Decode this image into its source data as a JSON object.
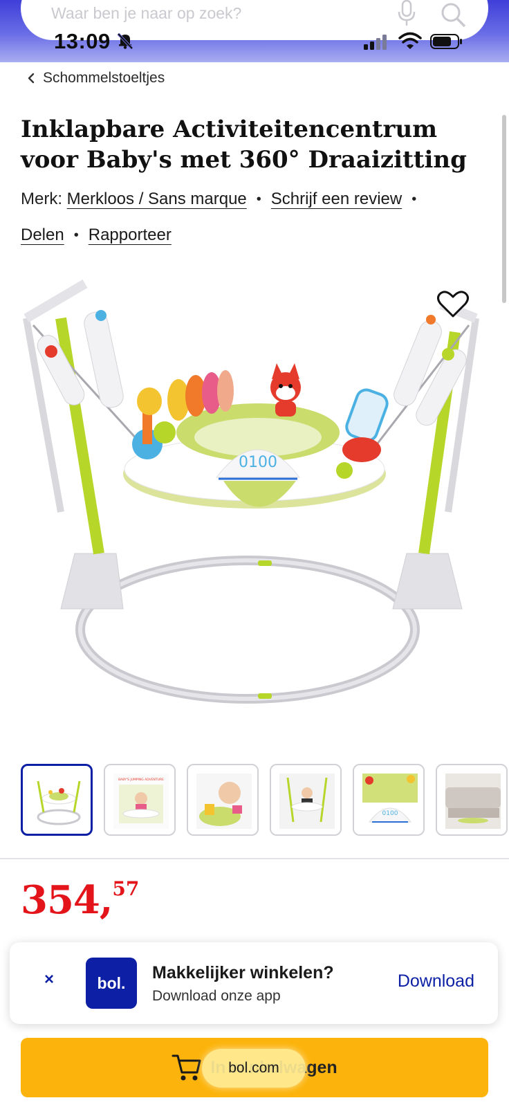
{
  "search": {
    "placeholder": "Waar ben je naar op zoek?"
  },
  "status_bar": {
    "time": "13:09"
  },
  "breadcrumb": {
    "label": "Schommelstoeltjes"
  },
  "product": {
    "title_line1": "Inklapbare Activiteitencentrum",
    "title_line2": "voor Baby's met 360° Draaizitting",
    "brand_prefix": "Merk:",
    "brand_name": "Merkloos / Sans marque",
    "review_link": "Schrijf een review",
    "share_link": "Delen",
    "report_link": "Rapporteer",
    "display_counter": "0100",
    "price_main": "354,",
    "price_cents": "57"
  },
  "thumbnails": {
    "count": 6,
    "active_index": 0,
    "thumb2_caption": "BABY'S JUMPING ADVENTURE",
    "thumb5_counter": "0100"
  },
  "app_banner": {
    "close": "×",
    "logo": "bol.",
    "title": "Makkelijker winkelen?",
    "subtitle": "Download onze app",
    "download": "Download"
  },
  "cart": {
    "label_partial": "In winkelwagen"
  },
  "browser": {
    "domain": "bol.com"
  },
  "colors": {
    "brand_blue": "#0d1fa5",
    "price_red": "#e3141a",
    "cart_yellow": "#fcb40c",
    "product_green": "#b7d62a"
  }
}
